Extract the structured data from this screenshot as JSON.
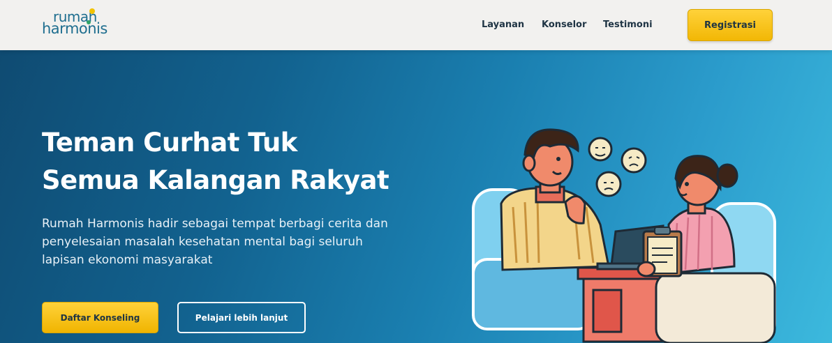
{
  "brand": {
    "line1": "rumah",
    "line2": "harmonis"
  },
  "nav": {
    "links": [
      "Layanan",
      "Konselor",
      "Testimoni"
    ],
    "cta_label": "Registrasi"
  },
  "hero": {
    "title_line1": "Teman Curhat Tuk",
    "title_line2": "Semua Kalangan Rakyat",
    "description": "Rumah Harmonis hadir sebagai tempat berbagi cerita dan penyelesaian masalah kesehatan mental bagi seluruh lapisan ekonomi masyarakat",
    "primary_button": "Daftar Konseling",
    "secondary_button": "Pelajari lebih lanjut"
  },
  "colors": {
    "brand_blue": "#1f6e8f",
    "accent_yellow": "#f5c518",
    "hero_dark": "#0f4b72",
    "hero_light": "#3cb9dd"
  },
  "illustration": {
    "icon": "counseling-session-illustration"
  }
}
